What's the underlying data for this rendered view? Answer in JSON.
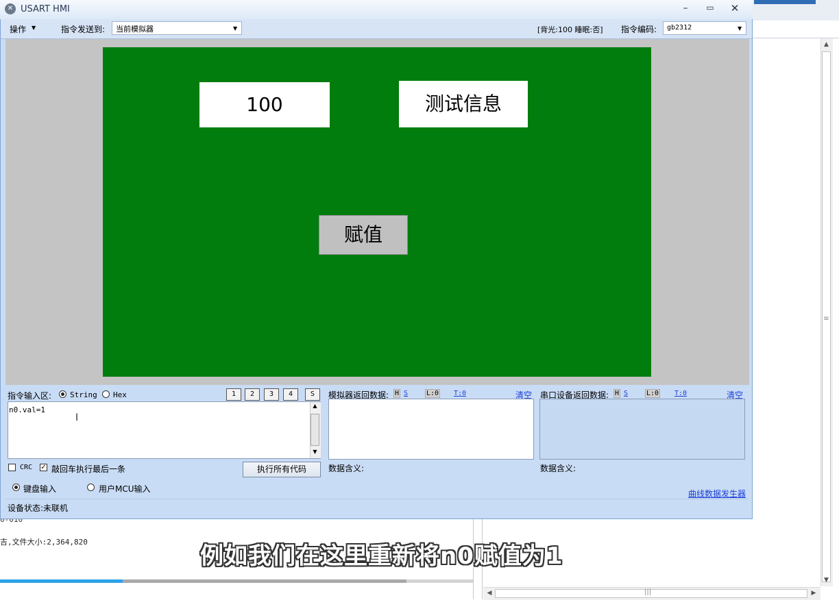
{
  "background": {
    "line1": "0-010",
    "line2": "吉,文件大小:2,364,820",
    "subtitle": "例如我们在这里重新将n0赋值为1",
    "video_progress": 0.26,
    "video_buffered": 0.86
  },
  "window": {
    "title": "USART HMI",
    "icon": "app-logo-icon",
    "controls": {
      "minimize": "–",
      "maximize": "▭",
      "close": "✕"
    }
  },
  "toolbar": {
    "menu_operate": "操作",
    "send_to_label": "指令发送到:",
    "send_to_value": "当前模拟器",
    "status": "[背光:100  睡眠:否]",
    "encoding_label": "指令编码:",
    "encoding_value": "gb2312"
  },
  "simulator": {
    "screen_color": "#017d0d",
    "n0_value": "100",
    "t0_text": "测试信息",
    "b0_label": "赋值"
  },
  "command": {
    "label": "指令输入区:",
    "mode_string": "String",
    "mode_hex": "Hex",
    "mode_selected": "String",
    "quick_buttons": [
      "1",
      "2",
      "3",
      "4",
      "S"
    ],
    "input_value": "n0.val=1",
    "crc_label": "CRC",
    "crc_checked": false,
    "enter_label": "敲回车执行最后一条",
    "enter_checked": true,
    "run_all": "执行所有代码",
    "input_keyboard": "键盘输入",
    "input_mcu": "用户MCU输入",
    "input_selected": "键盘输入"
  },
  "sim_return": {
    "label": "模拟器返回数据:",
    "h": "H",
    "s": "S",
    "l": "L:0",
    "t": "T:0",
    "clear": "清空",
    "meaning": "数据含义:"
  },
  "serial_return": {
    "label": "串口设备返回数据:",
    "h": "H",
    "s": "S",
    "l": "L:0",
    "t": "T:0",
    "clear": "清空",
    "meaning": "数据含义:"
  },
  "footer": {
    "device_status": "设备状态:未联机",
    "curve_generator": "曲线数据发生器"
  }
}
